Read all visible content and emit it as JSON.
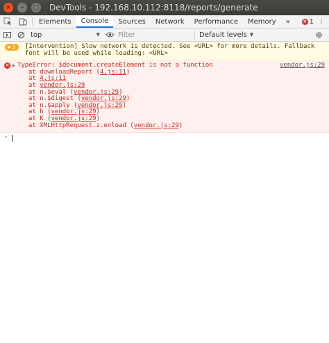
{
  "window": {
    "title": "DevTools - 192.168.10.112:8118/reports/generate",
    "close_glyph": "×",
    "min_glyph": "–",
    "max_glyph": "□"
  },
  "tabs": [
    {
      "label": "Elements"
    },
    {
      "label": "Console",
      "active": true
    },
    {
      "label": "Sources"
    },
    {
      "label": "Network"
    },
    {
      "label": "Performance"
    },
    {
      "label": "Memory"
    }
  ],
  "tab_right": {
    "more_glyph": "»",
    "error_count": "1",
    "menu_glyph": "⋮"
  },
  "toolbar": {
    "context": "top",
    "filter_placeholder": "Filter",
    "levels": "Default levels"
  },
  "messages": {
    "warning": {
      "count": "5",
      "text": "[Intervention] Slow network is detected. See <URL> for more details. Fallback font will be used while loading: <URL>"
    },
    "error": {
      "message": "TypeError: $document.createElement is not a function",
      "source": "vendor.js:29",
      "stack": [
        {
          "prefix": "at downloadReport (",
          "link": "4.js:11",
          "suffix": ")"
        },
        {
          "prefix": "at ",
          "link": "4.js:11",
          "suffix": ""
        },
        {
          "prefix": "at ",
          "link": "vendor.js:29",
          "suffix": ""
        },
        {
          "prefix": "at n.$eval (",
          "link": "vendor.js:29",
          "suffix": ")"
        },
        {
          "prefix": "at n.$digest (",
          "link": "vendor.js:29",
          "suffix": ")"
        },
        {
          "prefix": "at n.$apply (",
          "link": "vendor.js:29",
          "suffix": ")"
        },
        {
          "prefix": "at h (",
          "link": "vendor.js:29",
          "suffix": ")"
        },
        {
          "prefix": "at K (",
          "link": "vendor.js:29",
          "suffix": ")"
        },
        {
          "prefix": "at XMLHttpRequest.z.onload (",
          "link": "vendor.js:29",
          "suffix": ")"
        }
      ]
    }
  },
  "prompt_glyph": "›",
  "colors": {
    "accent": "#1a73e8",
    "error": "#d93025",
    "warning": "#f2ab26",
    "titlebar": "#3b3b37",
    "close_button": "#e95420"
  }
}
